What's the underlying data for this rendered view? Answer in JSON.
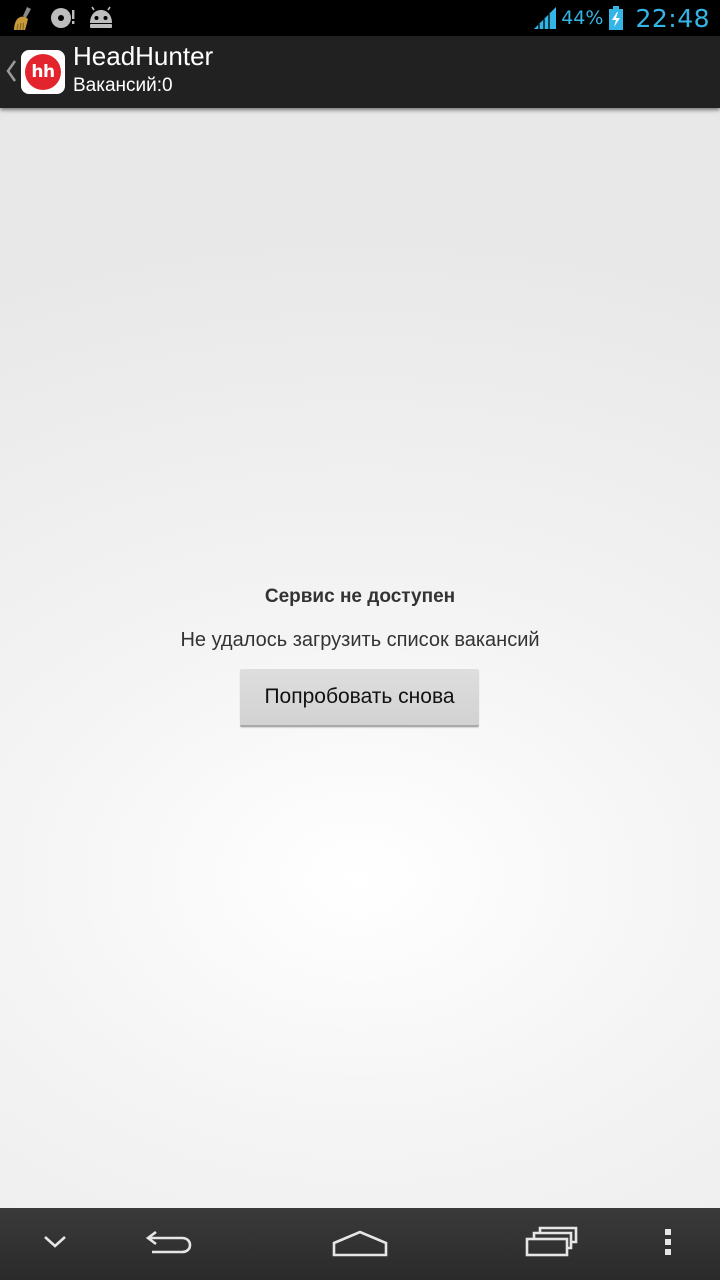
{
  "status_bar": {
    "battery_percent": "44%",
    "time": "22:48",
    "icons": [
      "cleaner-broom-icon",
      "sync-disc-icon",
      "android-debug-icon",
      "signal-icon",
      "battery-charging-icon"
    ],
    "accent_color": "#33b5e5"
  },
  "action_bar": {
    "logo_text": "hh",
    "title": "HeadHunter",
    "subtitle": "Вакансий:0"
  },
  "content": {
    "error_title": "Сервис не доступен",
    "error_message": "Не удалось загрузить список вакансий",
    "retry_label": "Попробовать снова"
  },
  "nav_bar": {
    "icons": [
      "chevron-down-icon",
      "back-icon",
      "home-icon",
      "recent-apps-icon",
      "overflow-menu-icon"
    ]
  },
  "colors": {
    "action_bar_bg": "#212121",
    "logo_red": "#e4242d",
    "content_bg": "#eeeeee"
  }
}
